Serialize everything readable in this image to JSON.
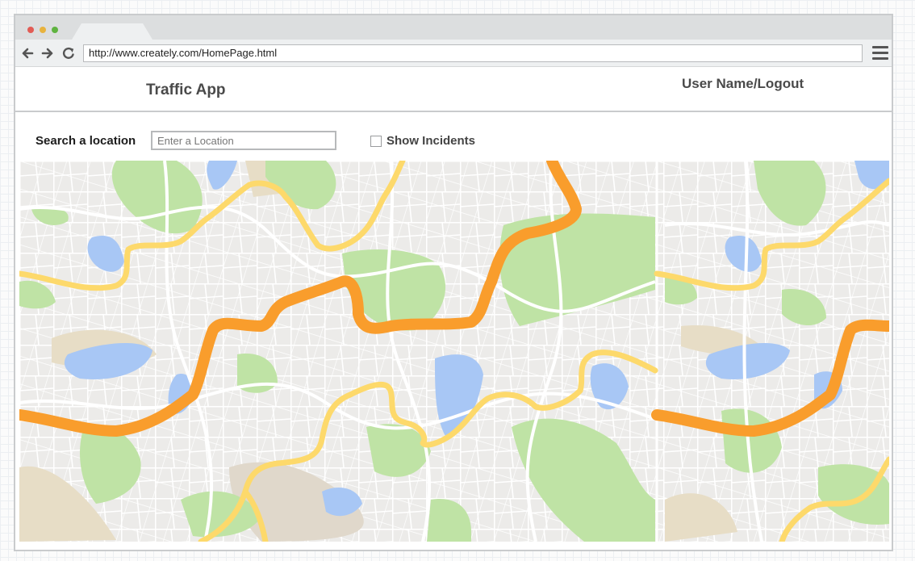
{
  "browser": {
    "url": "http://www.creately.com/HomePage.html",
    "nav": [
      "back-arrow-icon",
      "forward-arrow-icon",
      "refresh-icon"
    ],
    "menu_icon": "hamburger-menu-icon"
  },
  "header": {
    "title": "Traffic App",
    "user_link": "User Name/Logout"
  },
  "search": {
    "label": "Search a location",
    "placeholder": "Enter a Location",
    "value": ""
  },
  "incidents": {
    "label": "Show Incidents",
    "checked": false
  },
  "map": {
    "colors": {
      "background": "#ecebe9",
      "roads": "#ffffff",
      "park": "#bfe3a5",
      "water": "#a8c7f5",
      "urban": "#e7ddc6",
      "minor_highway": "#fdd96b",
      "major_highway": "#f99d2c"
    }
  }
}
